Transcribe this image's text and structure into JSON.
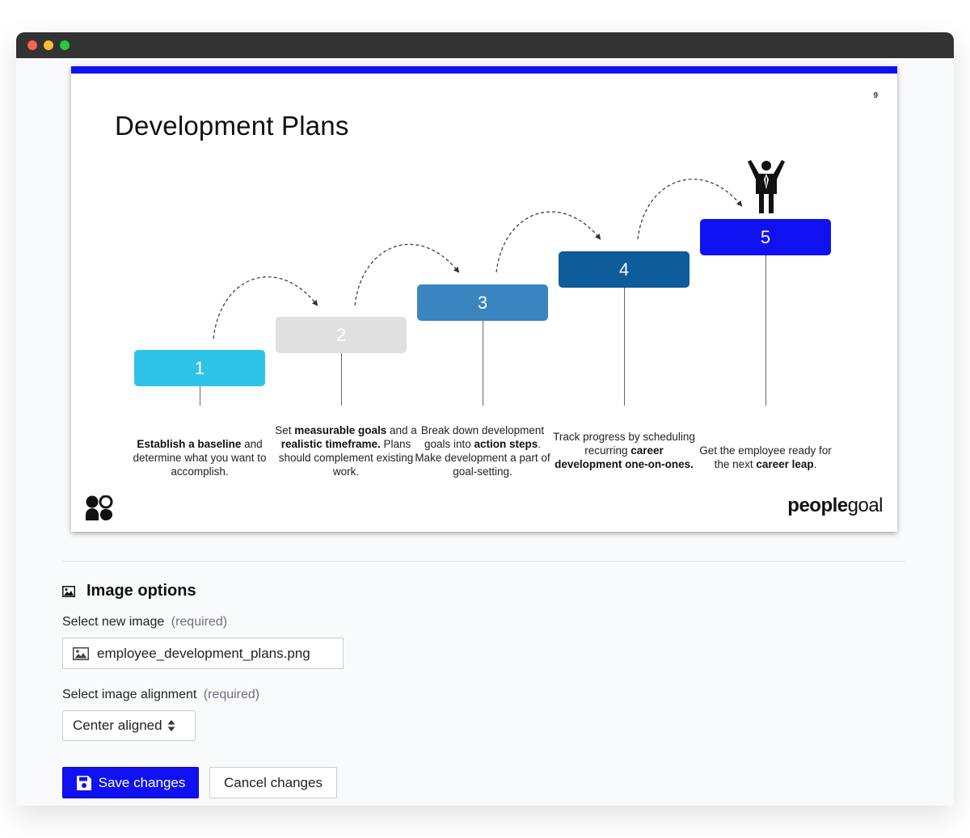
{
  "slide": {
    "page_number": "9",
    "title": "Development Plans",
    "brand_bold": "people",
    "brand_light": "goal",
    "steps": [
      {
        "number": "1",
        "color": "#2ec4ea",
        "text_html": "<b>Establish a baseline</b> and determine what you want to accomplish."
      },
      {
        "number": "2",
        "color": "#e0e0e0",
        "text_html": "Set <b>measurable goals</b> and a <b>realistic timeframe.</b> Plans should complement existing work."
      },
      {
        "number": "3",
        "color": "#3a84bf",
        "text_html": "Break down development goals into <b>action steps</b>. Make development a part of goal-setting."
      },
      {
        "number": "4",
        "color": "#0e5c9a",
        "text_html": "Track progress by scheduling recurring <b>career development one-on-ones.</b>"
      },
      {
        "number": "5",
        "color": "#0f11f0",
        "text_html": "Get the employee ready for the next <b>career leap</b>."
      }
    ]
  },
  "options": {
    "title": "Image options",
    "image_label": "Select new image",
    "required": "(required)",
    "image_value": "employee_development_plans.png",
    "alignment_label": "Select image alignment",
    "alignment_value": "Center aligned",
    "save_label": "Save changes",
    "cancel_label": "Cancel changes"
  },
  "icons": {
    "image": "image-icon",
    "file": "file-image-icon",
    "select": "select-arrows-icon",
    "save": "floppy-disk-icon",
    "person": "person-arms-raised-icon",
    "logo": "peoplegoal-logo-icon"
  }
}
